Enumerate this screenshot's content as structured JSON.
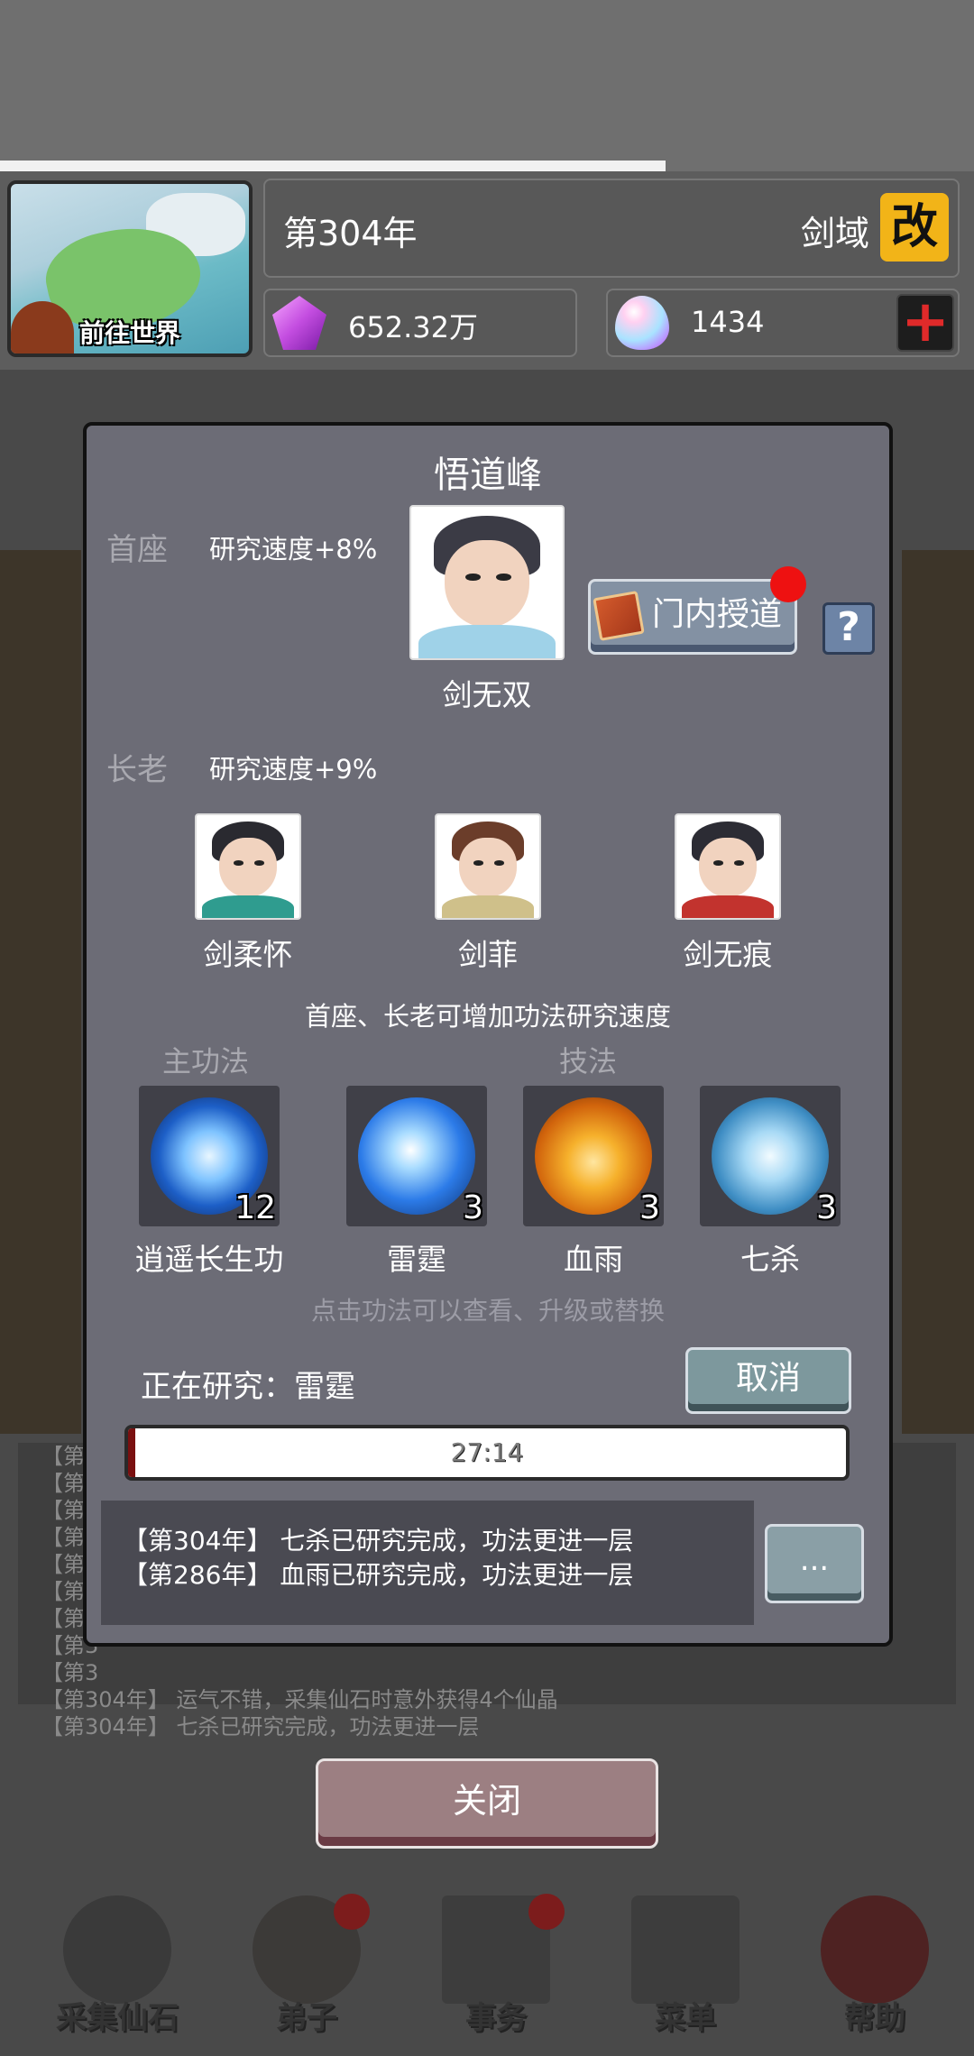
{
  "header": {
    "world_button": "前往世界",
    "year": "第304年",
    "realm": "剑域",
    "realm_badge": "改",
    "spirit_stones": "652.32万",
    "jade": "1434"
  },
  "dialog": {
    "title": "悟道峰",
    "head": {
      "role": "首座",
      "bonus": "研究速度+8%",
      "name": "剑无双"
    },
    "teach_button": "门内授道",
    "help": "?",
    "elders": {
      "role": "长老",
      "bonus": "研究速度+9%",
      "members": [
        "剑柔怀",
        "剑菲",
        "剑无痕"
      ]
    },
    "hint": "首座、长老可增加功法研究速度",
    "main_skill_label": "主功法",
    "tech_label": "技法",
    "skills": [
      {
        "name": "逍遥长生功",
        "level": "12",
        "icon": "yin-yang-orb-icon"
      },
      {
        "name": "雷霆",
        "level": "3",
        "icon": "lightning-orb-icon"
      },
      {
        "name": "血雨",
        "level": "3",
        "icon": "fire-fist-orb-icon"
      },
      {
        "name": "七杀",
        "level": "3",
        "icon": "swords-orb-icon"
      }
    ],
    "skill_hint": "点击功法可以查看、升级或替换",
    "researching_label": "正在研究：雷霆",
    "cancel_button": "取消",
    "progress_time": "27:14",
    "progress": 0.01,
    "logs": [
      "【第304年】 七杀已研究完成，功法更进一层",
      "【第286年】 血雨已研究完成，功法更进一层"
    ],
    "more_button": "..."
  },
  "background_log": [
    "【第",
    "【第3",
    "【第3",
    "【第3",
    "【第3",
    "【第3",
    "【第3",
    "【第3",
    "【第3",
    "【第304年】 运气不错，采集仙石时意外获得4个仙晶",
    "【第304年】 七杀已研究完成，功法更进一层"
  ],
  "close_button": "关闭",
  "nav": [
    {
      "label": "采集仙石",
      "icon": "pickaxe-icon"
    },
    {
      "label": "弟子",
      "icon": "disciple-icon"
    },
    {
      "label": "事务",
      "icon": "scroll-icon"
    },
    {
      "label": "菜单",
      "icon": "menu-icon"
    },
    {
      "label": "帮助",
      "icon": "help-icon"
    }
  ],
  "colors": {
    "accent_red": "#e11111",
    "badge_yellow": "#f2b418",
    "dialog_bg": "#6c6c76",
    "progress_fill": "#7a1010"
  }
}
